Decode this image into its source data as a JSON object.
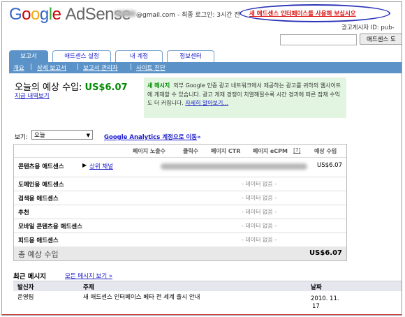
{
  "header": {
    "logo_parts": [
      "G",
      "o",
      "o",
      "g",
      "l",
      "e"
    ],
    "product": "AdSense",
    "email_suffix": "@gmail.com",
    "last_login": "- 최종 로그인: 3시간 전",
    "new_interface": "새 애드센스 인터페이스를 사용해 보십시오",
    "publisher_id": "광고게시자 ID: pub-",
    "search_button": "애드센스 도",
    "search_placeholder": ""
  },
  "tabs": [
    {
      "label": "보고서",
      "active": true
    },
    {
      "label": "애드센스 설정",
      "active": false
    },
    {
      "label": "내 계정",
      "active": false
    },
    {
      "label": "정보센터",
      "active": false
    }
  ],
  "subnav": {
    "items": [
      "개요",
      "상세 보고서",
      "보고서 관리자",
      "사이트 진단"
    ],
    "separator": "|"
  },
  "summary": {
    "label": "오늘의 예상 수입:",
    "amount": "US$6.07",
    "view_now": "지금 내역보기"
  },
  "message": {
    "name": "새 메시지",
    "body": "외부 Google 인증 광고 네트워크에서 제공하는 광고를 귀하의 웹사이트에 게재할 수 있습니다. 광고 게재 경쟁이 치열해질수록 시간 경과에 따른 잠재 수익도 더 커집니다.",
    "link": "자세히 알아보기..."
  },
  "view": {
    "label": "보기:",
    "selected": "오늘",
    "analytics_link": "Google Analytics 계정으로 이동",
    "analytics_suffix": "»"
  },
  "table": {
    "headers": [
      "페이지 노출수",
      "클릭수",
      "페이지 CTR",
      "페이지 eCPM",
      "[?]",
      "예상 수입"
    ],
    "content_row": {
      "label": "콘텐츠용 애드센스",
      "channel_link": "상위 채널",
      "value": "US$6.07"
    },
    "rows": [
      {
        "label": "도메인용 애드센스",
        "value": "- 데이터 없음 -"
      },
      {
        "label": "검색용 애드센스",
        "value": "- 데이터 없음 -"
      },
      {
        "label": "추천",
        "value": "- 데이터 없음 -"
      },
      {
        "label": "모바일 콘텐츠용 애드센스",
        "value": "- 데이터 없음 -"
      },
      {
        "label": "피드용 애드센스",
        "value": "- 데이터 없음 -"
      }
    ],
    "total_label": "총 예상 수입",
    "total_value": "US$6.07"
  },
  "recent": {
    "title": "최근 메시지",
    "view_all": "모든 메시지 보기 »",
    "headers": {
      "sender": "발신자",
      "subject": "주제",
      "date": "날짜"
    },
    "messages": [
      {
        "sender": "운영팀",
        "subject": "새 애드센스 인터페이스 베타 전 세계 출시 안내",
        "date_line1": "2010. 11.",
        "date_line2": "17"
      }
    ]
  },
  "colors": {
    "accent": "#5b93c9",
    "positive": "#008800",
    "alert": "#dd1111",
    "link": "#1a1acc",
    "message_bg": "#e2f5e0"
  }
}
